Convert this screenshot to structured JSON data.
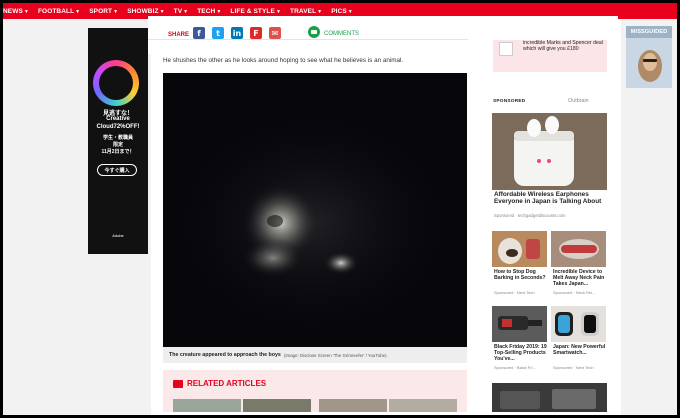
{
  "nav": {
    "items": [
      {
        "label": "NEWS"
      },
      {
        "label": "FOOTBALL"
      },
      {
        "label": "SPORT"
      },
      {
        "label": "SHOWBIZ"
      },
      {
        "label": "TV"
      },
      {
        "label": "TECH"
      },
      {
        "label": "LIFE & STYLE"
      },
      {
        "label": "TRAVEL"
      },
      {
        "label": "PICS"
      }
    ]
  },
  "share": {
    "label": "SHARE",
    "comments_label": "COMMENTS"
  },
  "article": {
    "paragraph": "He shushes the other as he looks around hoping to see what he believes is an animal.",
    "caption": "The creature appeared to approach the boys",
    "credit": "(Image: Disclose Screen 'The Grimreefer' / YouTube)"
  },
  "related": {
    "title": "RELATED ARTICLES"
  },
  "left_ad": {
    "line1": "見逃すな！",
    "line2": "Creative",
    "line3": "Cloud72%OFF!",
    "line4": "学生・教職員",
    "line5": "限定",
    "line6": "11月2日まで！",
    "button": "今すぐ購入",
    "brand": "Adobe"
  },
  "sidebar": {
    "top_ad_text": "incredible Marks and Spencer deal which will give you £180",
    "sponsored_label": "SPONSORED",
    "outbrain_label": "Outbrain",
    "main_story": {
      "title": "Affordable Wireless Earphones Everyone in Japan is Talking About",
      "source": "Sponsored · techgadgetdiscounts.com"
    },
    "items": [
      {
        "title": "How to Stop Dog Barking in Seconds?",
        "source": "Sponsored · Next Tech"
      },
      {
        "title": "Incredible Device to Melt Away Neck Pain Takes Japan...",
        "source": "Sponsored · Neck Rel..."
      },
      {
        "title": "Black Friday 2019: 19 Top-Selling Products You've...",
        "source": "Sponsored · Black Fri..."
      },
      {
        "title": "Japan: New Powerful Smartwatch...",
        "source": "Sponsored · Next Tech"
      }
    ]
  },
  "right_ad": {
    "brand": "MISSGUIDED"
  },
  "colors": {
    "brand_red": "#e8001c",
    "comments_green": "#1aa04a",
    "facebook": "#3b5998",
    "twitter": "#1da1f2",
    "linkedin": "#0077b5",
    "flipboard": "#e12828",
    "email": "#d9534f"
  }
}
